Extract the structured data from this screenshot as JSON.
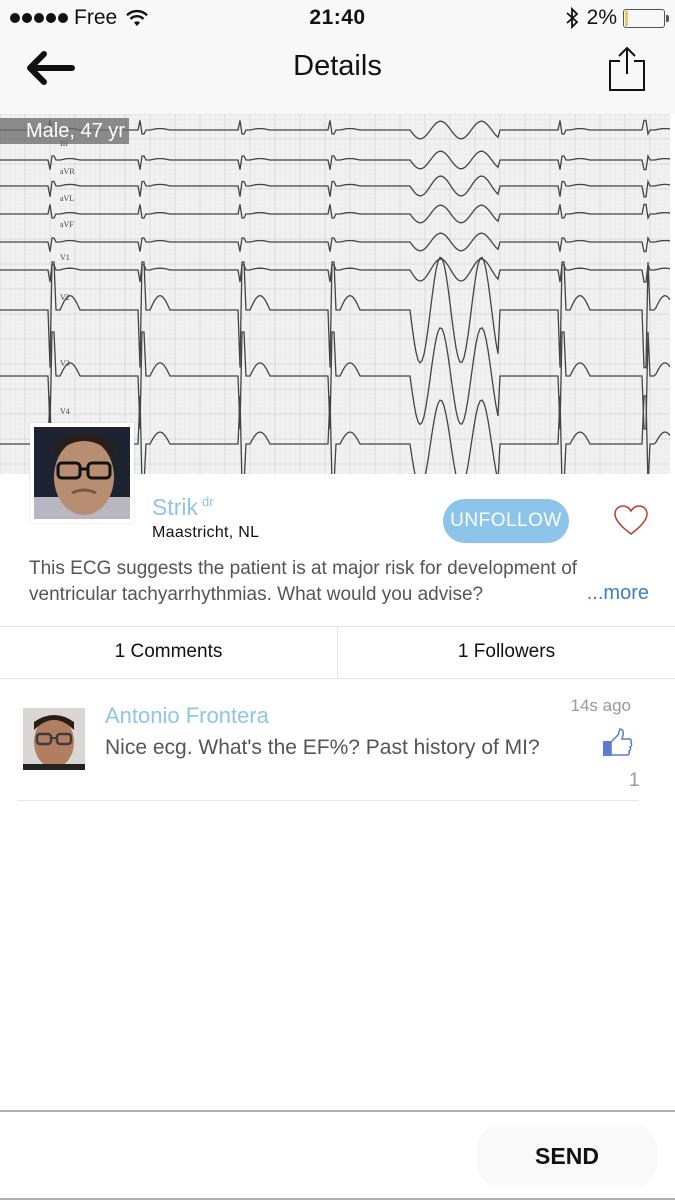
{
  "status_bar": {
    "signal_dots": 5,
    "carrier": "Free",
    "wifi_icon": "wifi-icon",
    "time": "21:40",
    "bluetooth_icon": "bluetooth-icon",
    "battery_percent": "2%",
    "battery_level": 0.02
  },
  "nav": {
    "back_icon": "arrow-left-icon",
    "title": "Details",
    "share_icon": "share-icon"
  },
  "post": {
    "image_label": "ECG tracing",
    "ecg_lead_labels": [
      "III",
      "aVR",
      "aVL",
      "aVF",
      "V1",
      "V2",
      "V3",
      "V4"
    ],
    "patient_tag": "Male, 47 yr",
    "author": {
      "name": "Strik",
      "title": "dr",
      "location": "Maastricht, NL"
    },
    "follow_button": "UNFOLLOW",
    "like_icon": "heart-outline-icon",
    "description": "This ECG suggests the patient is at major risk for development of ventricular tachyarrhythmias. What would you advise?",
    "more_link": "...more"
  },
  "tabs": [
    {
      "label": "1 Comments"
    },
    {
      "label": "1 Followers"
    }
  ],
  "comments": [
    {
      "author": "Antonio Frontera",
      "time": "14s ago",
      "text": "Nice ecg. What's the EF%? Past history of MI?",
      "like_icon": "thumbs-up-icon",
      "likes": "1"
    }
  ],
  "compose": {
    "placeholder": "",
    "send_label": "SEND"
  },
  "colors": {
    "accent_light_blue": "#8ec6e4",
    "unfollow_bg": "#8cc4ea",
    "link_blue": "#3a7fc4",
    "heart_red": "#c0392b",
    "thumb_blue": "#5b7bd5"
  }
}
